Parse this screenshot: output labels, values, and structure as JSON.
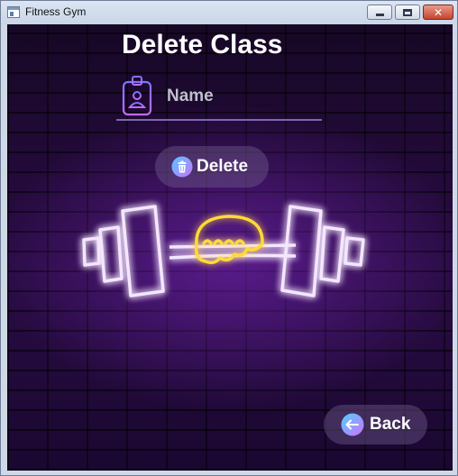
{
  "window": {
    "title": "Fitness Gym"
  },
  "page": {
    "heading": "Delete Class"
  },
  "name_field": {
    "placeholder": "Name",
    "value": ""
  },
  "buttons": {
    "delete_label": "Delete",
    "back_label": "Back"
  },
  "icons": {
    "app": "app-window-icon",
    "name": "id-badge-icon",
    "delete": "trash-icon",
    "back": "arrow-left-icon",
    "art": "neon-dumbbell-art"
  },
  "colors": {
    "background": "#1c0a30",
    "neon_purple": "#b05cff",
    "neon_yellow": "#ffcc22",
    "underline": "#7f66b3",
    "pill": "#6e5a8c"
  }
}
